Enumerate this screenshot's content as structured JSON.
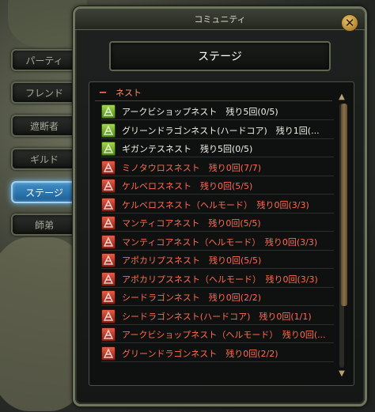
{
  "window": {
    "title": "コミュニティ",
    "close_symbol": "✕"
  },
  "side_tabs": [
    {
      "label": "パーティ",
      "active": false
    },
    {
      "label": "フレンド",
      "active": false
    },
    {
      "label": "遮断者",
      "active": false
    },
    {
      "label": "ギルド",
      "active": false
    },
    {
      "label": "ステージ",
      "active": true
    },
    {
      "label": "師弟",
      "active": false
    }
  ],
  "header": {
    "title": "ステージ"
  },
  "category": {
    "collapse_symbol": "−",
    "label": "ネスト"
  },
  "nests": [
    {
      "text": "アークビショップネスト　残り5回(0/5)",
      "status": "available"
    },
    {
      "text": "グリーンドラゴンネスト(ハードコア)　残り1回(...",
      "status": "available"
    },
    {
      "text": "ギガンテスネスト　残り5回(0/5)",
      "status": "available"
    },
    {
      "text": "ミノタウロスネスト　残り0回(7/7)",
      "status": "completed"
    },
    {
      "text": "ケルベロスネスト　残り0回(5/5)",
      "status": "completed"
    },
    {
      "text": "ケルベロスネスト（ヘルモード）　残り0回(3/3)",
      "status": "completed"
    },
    {
      "text": "マンティコアネスト　残り0回(5/5)",
      "status": "completed"
    },
    {
      "text": "マンティコアネスト（ヘルモード）　残り0回(3/3)",
      "status": "completed"
    },
    {
      "text": "アポカリプスネスト　残り0回(5/5)",
      "status": "completed"
    },
    {
      "text": "アポカリプスネスト（ヘルモード）　残り0回(3/3)",
      "status": "completed"
    },
    {
      "text": "シードラゴンネスト　残り0回(2/2)",
      "status": "completed"
    },
    {
      "text": "シードラゴンネスト(ハードコア)　残り0回(1/1)",
      "status": "completed"
    },
    {
      "text": "アークビショップネスト（ヘルモード）　残り0回(...",
      "status": "completed"
    },
    {
      "text": "グリーンドラゴンネスト　残り0回(2/2)",
      "status": "completed"
    }
  ],
  "scrollbar": {
    "up_symbol": "▲",
    "down_symbol": "▼"
  },
  "colors": {
    "available": "#f2f2ea",
    "completed": "#ff6a52",
    "active_tab": "#3f8ec7"
  }
}
